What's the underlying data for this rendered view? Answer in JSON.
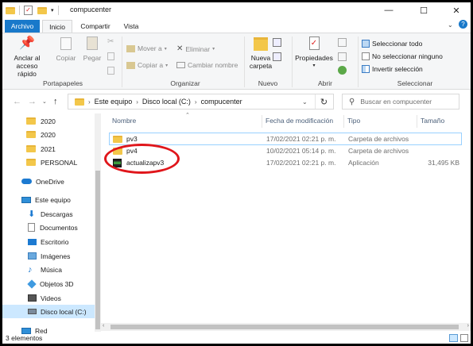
{
  "window": {
    "title": "compucenter"
  },
  "tabs": [
    "Archivo",
    "Inicio",
    "Compartir",
    "Vista"
  ],
  "ribbon": {
    "pin_label_1": "Anclar al",
    "pin_label_2": "acceso rápido",
    "copy": "Copiar",
    "paste": "Pegar",
    "portapapeles": "Portapapeles",
    "move_to": "Mover a",
    "copy_to": "Copiar a",
    "delete": "Eliminar",
    "rename": "Cambiar nombre",
    "organizar": "Organizar",
    "new_folder_1": "Nueva",
    "new_folder_2": "carpeta",
    "nuevo": "Nuevo",
    "properties": "Propiedades",
    "abrir": "Abrir",
    "select_all": "Seleccionar todo",
    "select_none": "No seleccionar ninguno",
    "invert": "Invertir selección",
    "seleccionar": "Seleccionar"
  },
  "address": {
    "crumbs": [
      "Este equipo",
      "Disco local (C:)",
      "compucenter"
    ],
    "search_placeholder": "Buscar en compucenter"
  },
  "nav": {
    "items": [
      "2020",
      "2020",
      "2021",
      "PERSONAL",
      "OneDrive",
      "Este equipo",
      "Descargas",
      "Documentos",
      "Escritorio",
      "Imágenes",
      "Música",
      "Objetos 3D",
      "Videos",
      "Disco local (C:)",
      "Red"
    ]
  },
  "columns": [
    "Nombre",
    "Fecha de modificación",
    "Tipo",
    "Tamaño"
  ],
  "files": [
    {
      "name": "pv3",
      "date": "17/02/2021 02:21 p. m.",
      "type": "Carpeta de archivos",
      "size": ""
    },
    {
      "name": "pv4",
      "date": "10/02/2021 05:14 p. m.",
      "type": "Carpeta de archivos",
      "size": ""
    },
    {
      "name": "actualizapv3",
      "date": "17/02/2021 02:21 p. m.",
      "type": "Aplicación",
      "size": "31,495 KB"
    }
  ],
  "status": {
    "count": "3 elementos"
  },
  "colors": {
    "accent": "#1979ca",
    "selection": "#cce8ff",
    "highlight_ring": "#e0161b"
  }
}
